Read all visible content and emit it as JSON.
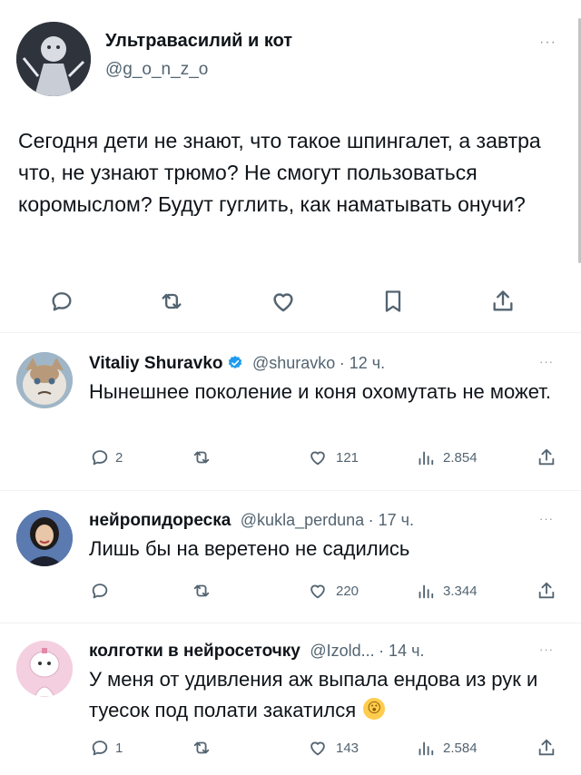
{
  "main_tweet": {
    "author_name": "Ультравасилий и кот",
    "handle": "@g_o_n_z_o",
    "text": "Сегодня дети не знают, что такое шпингалет, а завтра что, не узнают трюмо? Не смогут пользоваться коромыслом? Будут гуглить, как наматывать онучи?",
    "more": "···"
  },
  "replies": [
    {
      "author_name": "Vitaliy Shuravko",
      "handle": "@shuravko",
      "time": "· 12 ч.",
      "text": "Нынешнее поколение и коня охомутать не может.",
      "replies": "2",
      "likes": "121",
      "views": "2.854",
      "more": "···"
    },
    {
      "author_name": "нейропидореска",
      "handle": "@kukla_perduna",
      "time": "· 17 ч.",
      "text": "Лишь бы на веретено не садились",
      "replies": "",
      "likes": "220",
      "views": "3.344",
      "more": "···"
    },
    {
      "author_name": "колготки в нейросеточку",
      "handle": "@Izold...",
      "time": "· 14 ч.",
      "text": "У меня от удивления аж выпала ендова из рук и туесок под полати закатился",
      "emoji": "😮",
      "replies": "1",
      "likes": "143",
      "views": "2.584",
      "more": "···"
    }
  ],
  "colors": {
    "text": "#0f1419",
    "secondary": "#536471",
    "verified": "#1d9bf0",
    "divider": "#eff3f4"
  }
}
